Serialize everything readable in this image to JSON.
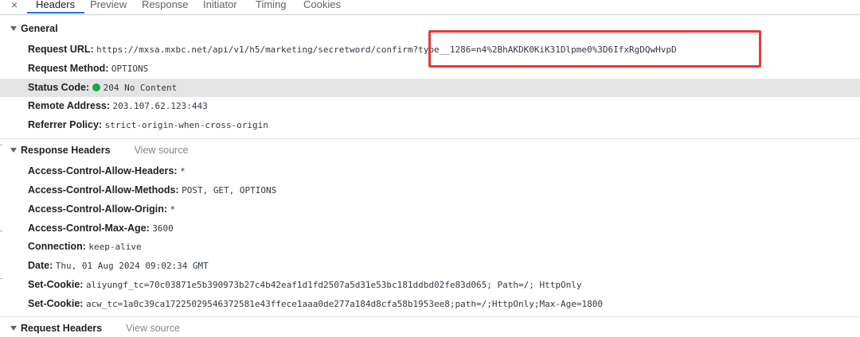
{
  "tabs": {
    "close": "×",
    "items": [
      "Headers",
      "Preview",
      "Response",
      "Initiator",
      "Timing",
      "Cookies"
    ]
  },
  "general": {
    "title": "General",
    "request_url_label": "Request URL:",
    "request_url": "https://mxsa.mxbc.net/api/v1/h5/marketing/secretword/confirm?type__1286=n4%2BhAKDK0KiK31Dlpme0%3D6IfxRgDQwHvpD",
    "request_method_label": "Request Method:",
    "request_method": "OPTIONS",
    "status_code_label": "Status Code:",
    "status_code": "204 No Content",
    "status_color": "#1ea446",
    "remote_address_label": "Remote Address:",
    "remote_address": "203.107.62.123:443",
    "referrer_policy_label": "Referrer Policy:",
    "referrer_policy": "strict-origin-when-cross-origin"
  },
  "response_headers": {
    "title": "Response Headers",
    "view_source": "View source",
    "items": [
      {
        "name": "Access-Control-Allow-Headers:",
        "value": "*"
      },
      {
        "name": "Access-Control-Allow-Methods:",
        "value": "POST, GET, OPTIONS"
      },
      {
        "name": "Access-Control-Allow-Origin:",
        "value": "*"
      },
      {
        "name": "Access-Control-Max-Age:",
        "value": "3600"
      },
      {
        "name": "Connection:",
        "value": "keep-alive"
      },
      {
        "name": "Date:",
        "value": "Thu, 01 Aug 2024 09:02:34 GMT"
      },
      {
        "name": "Set-Cookie:",
        "value": "aliyungf_tc=70c03871e5b390973b27c4b42eaf1d1fd2507a5d31e53bc181ddbd02fe83d065; Path=/; HttpOnly"
      },
      {
        "name": "Set-Cookie:",
        "value": "acw_tc=1a0c39ca17225029546372581e43ffece1aaa0de277a184d8cfa58b1953ee8;path=/;HttpOnly;Max-Age=1800"
      }
    ]
  },
  "request_headers": {
    "title": "Request Headers",
    "view_source": "View source"
  },
  "annotation": {
    "color": "#e53935"
  }
}
